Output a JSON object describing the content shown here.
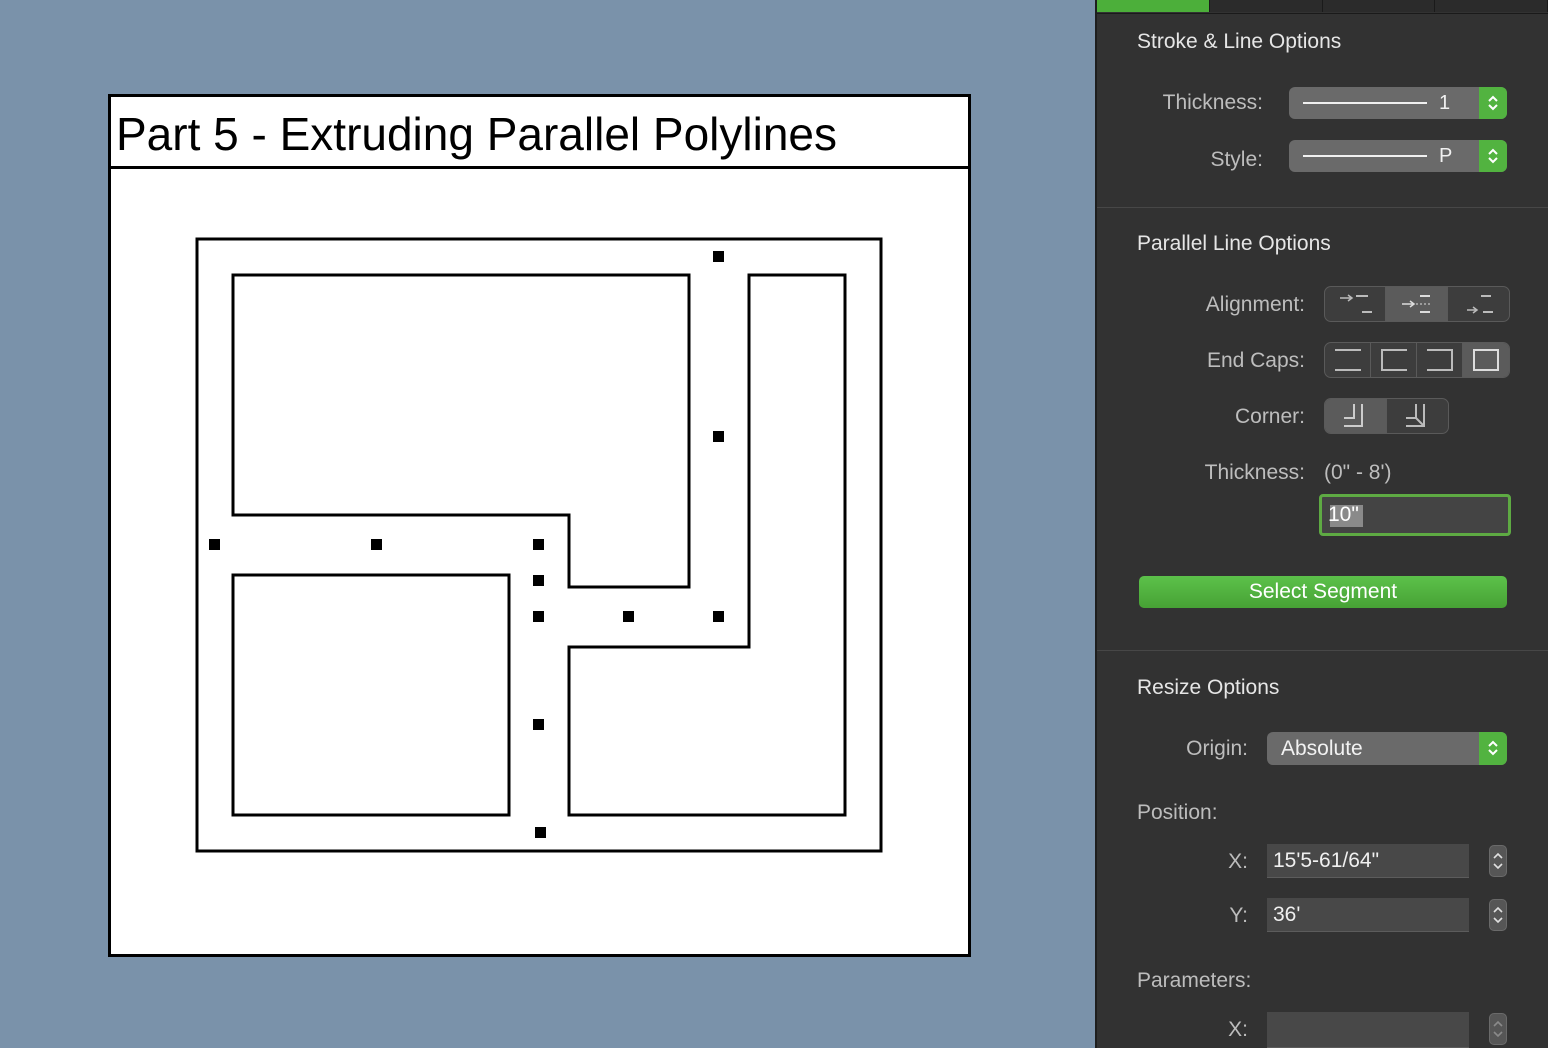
{
  "canvas": {
    "title": "Part 5 - Extruding Parallel Polylines"
  },
  "panel": {
    "tabs": [
      "",
      "",
      "",
      ""
    ],
    "stroke": {
      "title": "Stroke & Line Options",
      "thickness_label": "Thickness:",
      "thickness_value": "1",
      "style_label": "Style:",
      "style_value": "P"
    },
    "parallel": {
      "title": "Parallel Line Options",
      "alignment_label": "Alignment:",
      "endcaps_label": "End Caps:",
      "corner_label": "Corner:",
      "thickness_label": "Thickness:",
      "thickness_range": "(0\" - 8')",
      "thickness_value": "10\"",
      "select_segment": "Select Segment"
    },
    "resize": {
      "title": "Resize Options",
      "origin_label": "Origin:",
      "origin_value": "Absolute",
      "position_label": "Position:",
      "x_label": "X:",
      "x_value": "15'5-61/64\"",
      "y_label": "Y:",
      "y_value": "36'",
      "parameters_label": "Parameters:",
      "param_x_label": "X:",
      "param_x_value": ""
    }
  },
  "colors": {
    "canvas_bg": "#7a92aa",
    "panel_bg": "#323232",
    "accent_green": "#52b340"
  },
  "icons": {
    "alignment": [
      "align-left-icon",
      "align-center-icon",
      "align-right-icon"
    ],
    "endcaps": [
      "cap-none-icon",
      "cap-start-icon",
      "cap-end-icon",
      "cap-both-icon"
    ],
    "corner": [
      "corner-square-icon",
      "corner-miter-icon"
    ],
    "stepper": "up-down-chevron-icon"
  }
}
